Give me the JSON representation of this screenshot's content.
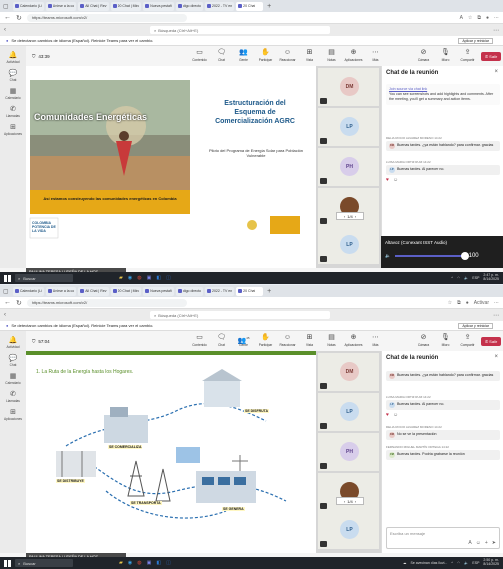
{
  "colors": {
    "accent": "#5b5fc7",
    "leave": "#c4314b",
    "slide_title": "#1e5a8a",
    "slide_band": "#e6a817",
    "slide_green": "#5a8f2a"
  },
  "browser": {
    "tabs_top": [
      "Calendario (Li",
      "Unirse a la co",
      "All Chat | Rev",
      "20 Chat | Mirc",
      "Nueva pestañ",
      "digo directo",
      "2022 - TV en",
      "20 Chat"
    ],
    "tabs_bottom": [
      "Calendario (Li",
      "Unirse a la co",
      "All Chat | Rev",
      "20 Chat | Mirc",
      "Nueva pestañ",
      "digo directo",
      "2022 - TV en",
      "20 Chat"
    ],
    "url": "https://teams.microsoft.com/v2/",
    "activate_label": "Activar"
  },
  "teams": {
    "search_placeholder": "Búsqueda (Ctrl+Alt+E)",
    "banner_text": "Se detectaron cambios de idioma (Español). Reinicie Teams para ver el cambio.",
    "banner_button": "Aplicar y reiniciar",
    "rail": [
      "Actividad",
      "Chat",
      "Calendario",
      "Llamadas",
      "Aplicaciones"
    ],
    "controls": [
      "Contenido",
      "Chat",
      "Gente",
      "Participar",
      "Reaccionar",
      "Vista",
      "Notas",
      "Aplicaciones",
      "Más"
    ],
    "controls_right": [
      "Cámara",
      "Micro",
      "Compartir"
    ],
    "leave_label": "Salir",
    "people_count": "45"
  },
  "shot1": {
    "timer": "43:39",
    "slide": {
      "title_lines": [
        "Estructuración del",
        "Esquema de",
        "Comercialización AGRC"
      ],
      "subtitle": "Piloto del Programa de Energía Solar para Población Vulnerable",
      "overlay_title": "Comunidades Energéticas",
      "band_text": "Así estamos construyendo las comunidades energéticas en Colombia",
      "logo_text": "COLOMBIA POTENCIA DE LA VIDA"
    },
    "tiles": [
      "DM",
      "LP",
      "PH",
      "",
      "LP"
    ],
    "pager": "1/4",
    "now_presenting": "PAULINA TERESA LUDEÑA DE LA HOZ",
    "chat": {
      "title": "Chat de la reunión",
      "intro_link": "Join source via chat link",
      "intro_text": "You can see screenshots and add highlights and comments. After the meeting, you'll get a summary and action items.",
      "messages": [
        {
          "author": "DELIA ROCIO ALVAREZ MORENO 14:22",
          "initials": "DM",
          "text": "Buenas tardes. ¿ya están hablando? para confirmar. gracias"
        },
        {
          "author": "LUISA MARIA ORTIZ RUIZ 14:22",
          "initials": "LP",
          "text": "Buenas tardes. Al parecer no."
        }
      ]
    },
    "audio_panel": {
      "title": "Altavoz (Conexant ISST Audio)",
      "value": "100",
      "level": 1.0
    },
    "taskbar_time": "2:47 p. m.",
    "taskbar_date": "8/14/2025",
    "taskbar_search": "Buscar",
    "taskbar_lang": "ESP"
  },
  "shot2": {
    "timer": "57:04",
    "diagram": {
      "heading": "1. La Ruta de la Energía hasta los Hogares.",
      "labels": [
        "SE DISFRUTA",
        "SE COMERCIALIZA",
        "SE DISTRIBUYE",
        "SE TRANSPORTA",
        "SE GENERA"
      ]
    },
    "tiles": [
      "DM",
      "LP",
      "PH",
      "",
      "LP"
    ],
    "pager": "1/4",
    "now_presenting": "PAULINA TERESA LUDEÑA DE LA HOZ",
    "chat": {
      "title": "Chat de la reunión",
      "messages": [
        {
          "author": "",
          "initials": "DM",
          "text": "Buenas tardes. ¿ya están hablando? para confirmar. gracias"
        },
        {
          "author": "LUISA MARIA ORTIZ RUIZ 14:22",
          "initials": "LP",
          "text": "Buenas tardes. Al parecer no."
        },
        {
          "author": "DELIA ROCIO ALVAREZ MORENO 14:22",
          "initials": "DM",
          "text": "No se ve la presentación"
        },
        {
          "author": "FERNANDO MIGUEL MARTÍN ORTEGA 14:22",
          "initials": "FM",
          "text": "Buenas tardes. Podría grabarse la reunión"
        }
      ],
      "compose_placeholder": "Escriba un mensaje"
    },
    "taskbar_notice": "Se avecinan días lluvi...",
    "taskbar_time": "2:50 p. m.",
    "taskbar_date": "8/14/2025",
    "taskbar_search": "Buscar",
    "taskbar_lang": "ESP"
  }
}
